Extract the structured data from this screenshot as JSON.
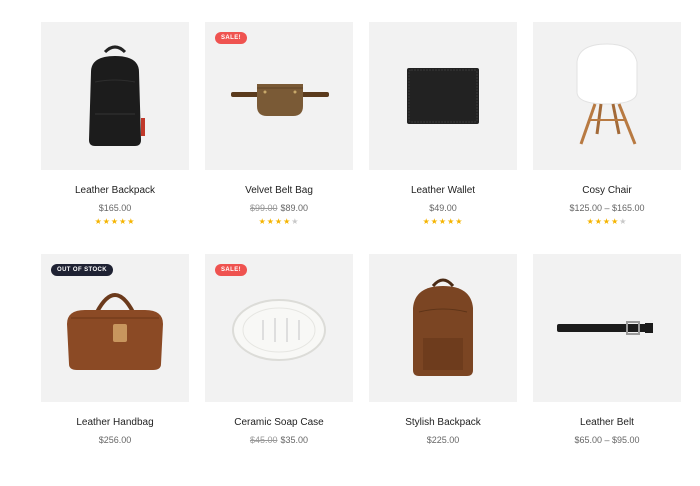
{
  "products": [
    {
      "title": "Leather Backpack",
      "price": "$165.00",
      "old_price": "",
      "badge": "",
      "rating": 5,
      "icon": "backpack-black-icon"
    },
    {
      "title": "Velvet Belt Bag",
      "price": "$89.00",
      "old_price": "$99.00",
      "badge": "SALE!",
      "rating": 4,
      "icon": "belt-bag-icon"
    },
    {
      "title": "Leather Wallet",
      "price": "$49.00",
      "old_price": "",
      "badge": "",
      "rating": 5,
      "icon": "wallet-icon"
    },
    {
      "title": "Cosy Chair",
      "price": "$125.00 – $165.00",
      "old_price": "",
      "badge": "",
      "rating": 4,
      "icon": "chair-icon"
    },
    {
      "title": "Leather Handbag",
      "price": "$256.00",
      "old_price": "",
      "badge": "OUT OF STOCK",
      "rating": 0,
      "icon": "handbag-icon"
    },
    {
      "title": "Ceramic Soap Case",
      "price": "$35.00",
      "old_price": "$45.00",
      "badge": "SALE!",
      "rating": 0,
      "icon": "soap-case-icon"
    },
    {
      "title": "Stylish Backpack",
      "price": "$225.00",
      "old_price": "",
      "badge": "",
      "rating": 0,
      "icon": "backpack-brown-icon"
    },
    {
      "title": "Leather Belt",
      "price": "$65.00 – $95.00",
      "old_price": "",
      "badge": "",
      "rating": 0,
      "icon": "belt-icon"
    }
  ],
  "colors": {
    "sale": "#ef5350",
    "out_of_stock": "#1f2233",
    "star": "#f5b400",
    "thumb_bg": "#f2f2f2"
  }
}
